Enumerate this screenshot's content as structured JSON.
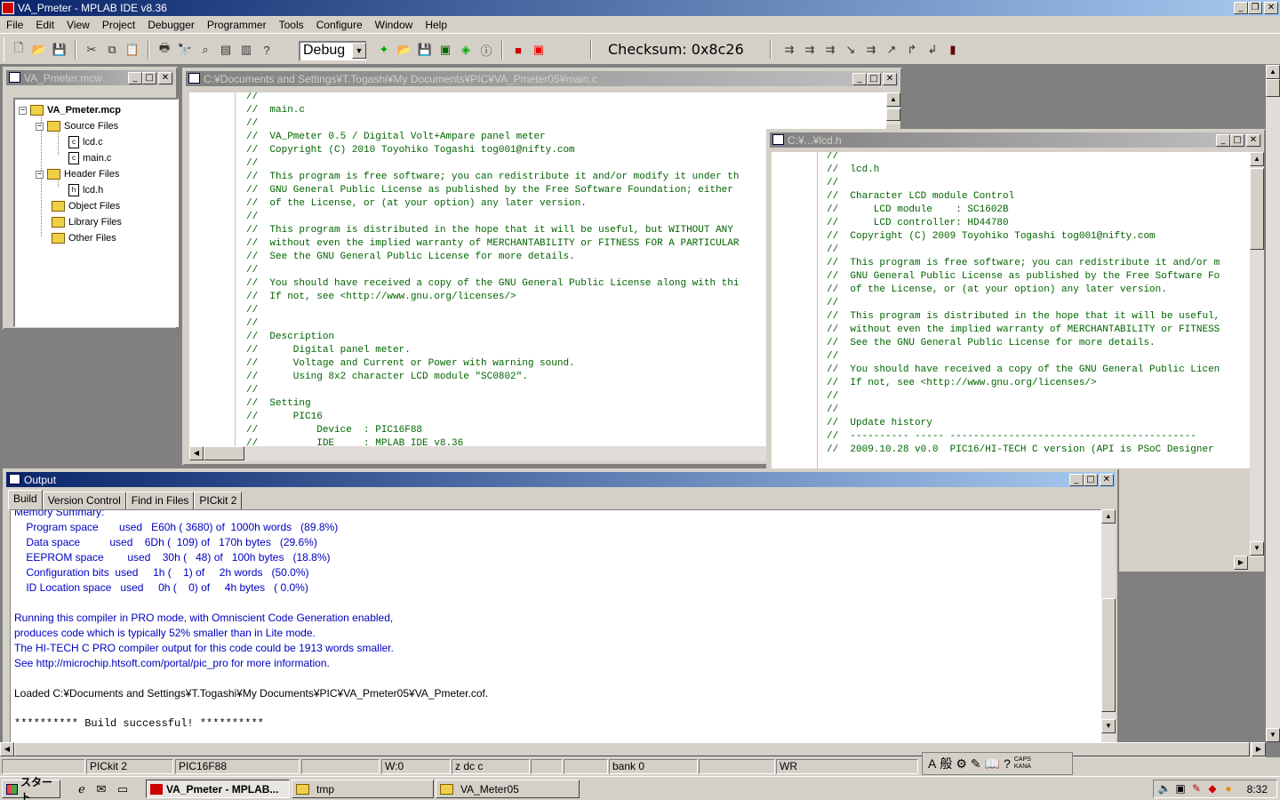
{
  "app": {
    "title": "VA_Pmeter - MPLAB IDE v8.36"
  },
  "menu": [
    "File",
    "Edit",
    "View",
    "Project",
    "Debugger",
    "Programmer",
    "Tools",
    "Configure",
    "Window",
    "Help"
  ],
  "toolbar": {
    "config": "Debug",
    "checksum": "Checksum: 0x8c26",
    "icons": [
      "new-file-icon",
      "open-icon",
      "save-icon",
      "cut-icon",
      "copy-icon",
      "paste-icon",
      "print-icon",
      "find-icon",
      "find-in-files-icon",
      "workspace-icon",
      "output-icon",
      "help-icon"
    ]
  },
  "project": {
    "title": "VA_Pmeter.mcw",
    "root": "VA_Pmeter.mcp",
    "source_folder": "Source Files",
    "source_files": [
      "lcd.c",
      "main.c"
    ],
    "header_folder": "Header Files",
    "header_files": [
      "lcd.h"
    ],
    "object_folder": "Object Files",
    "library_folder": "Library Files",
    "other_folder": "Other Files"
  },
  "main_editor": {
    "title": "C:¥Documents and Settings¥T.Togashi¥My Documents¥PIC¥VA_Pmeter05¥main.c",
    "lines": [
      "//",
      "//  main.c",
      "//",
      "//  VA_Pmeter 0.5 / Digital Volt+Ampare panel meter",
      "//  Copyright (C) 2010 Toyohiko Togashi tog001@nifty.com",
      "//",
      "//  This program is free software; you can redistribute it and/or modify it under th",
      "//  GNU General Public License as published by the Free Software Foundation; either",
      "//  of the License, or (at your option) any later version.",
      "//",
      "//  This program is distributed in the hope that it will be useful, but WITHOUT ANY",
      "//  without even the implied warranty of MERCHANTABILITY or FITNESS FOR A PARTICULAR",
      "//  See the GNU General Public License for more details.",
      "//",
      "//  You should have received a copy of the GNU General Public License along with thi",
      "//  If not, see <http://www.gnu.org/licenses/>",
      "//",
      "//",
      "//  Description",
      "//      Digital panel meter.",
      "//      Voltage and Current or Power with warning sound.",
      "//      Using 8x2 character LCD module \"SC0802\".",
      "//",
      "//  Setting",
      "//      PIC16",
      "//          Device  : PIC16F88",
      "//          IDE     : MPLAB IDE v8.36"
    ]
  },
  "lcd_editor": {
    "title": "C:¥...¥lcd.h",
    "lines": [
      "//",
      "//  lcd.h",
      "//",
      "//  Character LCD module Control",
      "//      LCD module    : SC1602B",
      "//      LCD controller: HD44780",
      "//  Copyright (C) 2009 Toyohiko Togashi tog001@nifty.com",
      "//",
      "//  This program is free software; you can redistribute it and/or m",
      "//  GNU General Public License as published by the Free Software Fo",
      "//  of the License, or (at your option) any later version.",
      "//",
      "//  This program is distributed in the hope that it will be useful,",
      "//  without even the implied warranty of MERCHANTABILITY or FITNESS",
      "//  See the GNU General Public License for more details.",
      "//",
      "//  You should have received a copy of the GNU General Public Licen",
      "//  If not, see <http://www.gnu.org/licenses/>",
      "//",
      "//",
      "//  Update history",
      "//  ---------- ----- ------------------------------------------",
      "//  2009.10.28 v0.0  PIC16/HI-TECH C version (API is PSoC Designer"
    ]
  },
  "output": {
    "title": "Output",
    "tabs": [
      "Build",
      "Version Control",
      "Find in Files",
      "PICkit 2"
    ],
    "lines": [
      {
        "text": "Memory Summary:",
        "style": ""
      },
      {
        "text": "    Program space       used   E60h ( 3680) of  1000h words   (89.8%)",
        "style": ""
      },
      {
        "text": "    Data space          used    6Dh (  109) of   170h bytes   (29.6%)",
        "style": ""
      },
      {
        "text": "    EEPROM space        used    30h (   48) of   100h bytes   (18.8%)",
        "style": ""
      },
      {
        "text": "    Configuration bits  used     1h (    1) of     2h words   (50.0%)",
        "style": ""
      },
      {
        "text": "    ID Location space   used     0h (    0) of     4h bytes   ( 0.0%)",
        "style": ""
      },
      {
        "text": "",
        "style": ""
      },
      {
        "text": "Running this compiler in PRO mode, with Omniscient Code Generation enabled,",
        "style": ""
      },
      {
        "text": "produces code which is typically 52% smaller than in Lite mode.",
        "style": ""
      },
      {
        "text": "The HI-TECH C PRO compiler output for this code could be 1913 words smaller.",
        "style": ""
      },
      {
        "text": "See http://microchip.htsoft.com/portal/pic_pro for more information.",
        "style": ""
      },
      {
        "text": "",
        "style": ""
      },
      {
        "text": "Loaded C:¥Documents and Settings¥T.Togashi¥My Documents¥PIC¥VA_Pmeter05¥VA_Pmeter.cof.",
        "style": "black"
      },
      {
        "text": "",
        "style": ""
      },
      {
        "text": "********** Build successful! **********",
        "style": "mono"
      }
    ]
  },
  "status": {
    "programmer": "PICkit 2",
    "device": "PIC16F88",
    "w": "W:0",
    "flags": "z dc c",
    "bank": "bank 0",
    "wr": "WR"
  },
  "ime": {
    "mode": "A",
    "kana": "般",
    "caps": "CAPS KANA"
  },
  "taskbar": {
    "start": "スタート",
    "tasks": [
      "VA_Pmeter - MPLAB...",
      "tmp",
      "VA_Meter05"
    ],
    "clock": "8:32"
  },
  "colors": {
    "title_active": "#0a246a",
    "code_comment": "#006400",
    "output_text": "#0000c0"
  }
}
